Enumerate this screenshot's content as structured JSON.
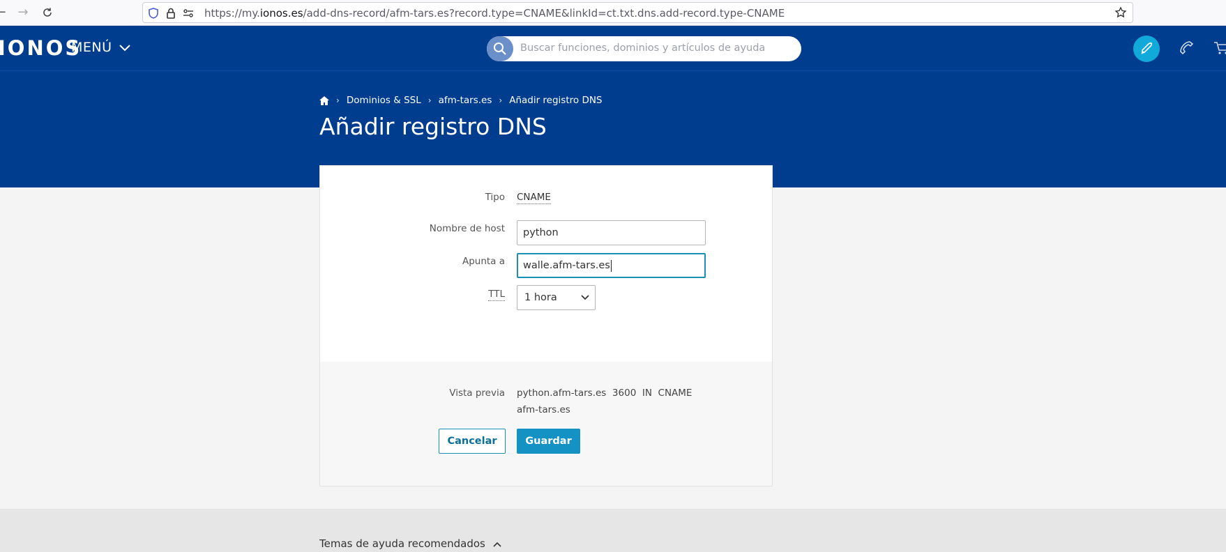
{
  "browser": {
    "url_prefix": "https://my.",
    "url_host": "ionos.es",
    "url_path": "/add-dns-record/afm-tars.es?record.type=CNAME&linkId=ct.txt.dns.add-record.type-CNAME"
  },
  "header": {
    "logo": "IONOS",
    "menu_label": "MENÚ",
    "search_placeholder": "Buscar funciones, dominios y artículos de ayuda"
  },
  "breadcrumb": {
    "items": [
      "Dominios & SSL",
      "afm-tars.es",
      "Añadir registro DNS"
    ]
  },
  "page": {
    "title": "Añadir registro DNS"
  },
  "form": {
    "tipo_label": "Tipo",
    "tipo_value": "CNAME",
    "host_label": "Nombre de host",
    "host_value": "python",
    "points_label": "Apunta a",
    "points_value": "walle.afm-tars.es",
    "ttl_label": "TTL",
    "ttl_value": "1 hora"
  },
  "preview": {
    "label": "Vista previa",
    "line1": "python.afm-tars.es  3600  IN  CNAME",
    "line2": "afm-tars.es"
  },
  "actions": {
    "cancel_label": "Cancelar",
    "save_label": "Guardar"
  },
  "help": {
    "title": "Temas de ayuda recomendados"
  },
  "colors": {
    "brand_blue": "#003d8f",
    "accent": "#1592c4"
  }
}
